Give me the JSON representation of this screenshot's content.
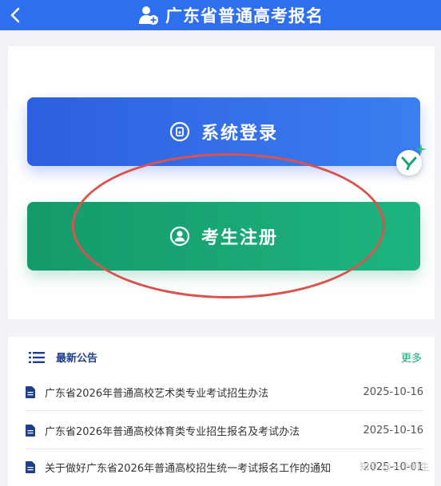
{
  "header": {
    "title": "广东省普通高考报名",
    "back_icon": "chevron-left-icon",
    "title_icon": "user-add-icon",
    "color": "#2e6ff0"
  },
  "buttons": {
    "login": {
      "label": "系统登录",
      "icon": "login-badge-icon",
      "color": "#2d5fe0"
    },
    "register": {
      "label": "考生注册",
      "icon": "user-circle-icon",
      "color": "#159a6a"
    }
  },
  "annotation_color": "#d9534f",
  "news": {
    "title": "最新公告",
    "more_label": "更多",
    "items": [
      {
        "text": "广东省2026年普通高校艺术类专业考试招生办法",
        "date": "2025-10-16"
      },
      {
        "text": "广东省2026年普通高校体育类专业招生报名及考试办法",
        "date": "2025-10-16"
      },
      {
        "text": "关于做好广东省2026年普通高校招生统一考试报名工作的通知",
        "date": "2025-10-01"
      }
    ]
  },
  "watermark": "知乎 @一个机生"
}
